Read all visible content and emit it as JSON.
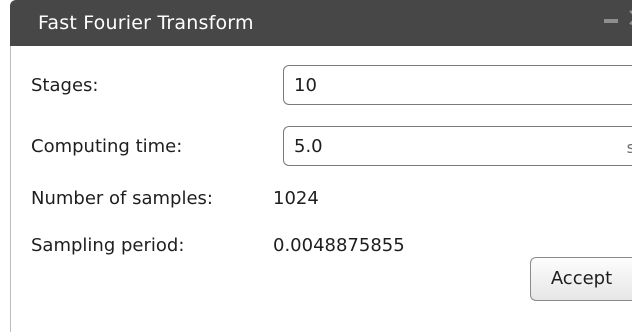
{
  "window": {
    "title": "Fast Fourier Transform"
  },
  "form": {
    "stages_label": "Stages:",
    "stages_value": "10",
    "computing_time_label": "Computing time:",
    "computing_time_value": "5.0",
    "computing_time_unit": "s",
    "num_samples_label": "Number of samples:",
    "num_samples_value": "1024",
    "sampling_period_label": "Sampling period:",
    "sampling_period_value": "0.0048875855"
  },
  "actions": {
    "accept_label": "Accept"
  },
  "icons": {
    "minimize": "minimize-icon",
    "close": "close-icon"
  },
  "colors": {
    "titlebar": "#474747",
    "title_text": "#ffffff",
    "title_buttons": "#8e8e8e"
  }
}
